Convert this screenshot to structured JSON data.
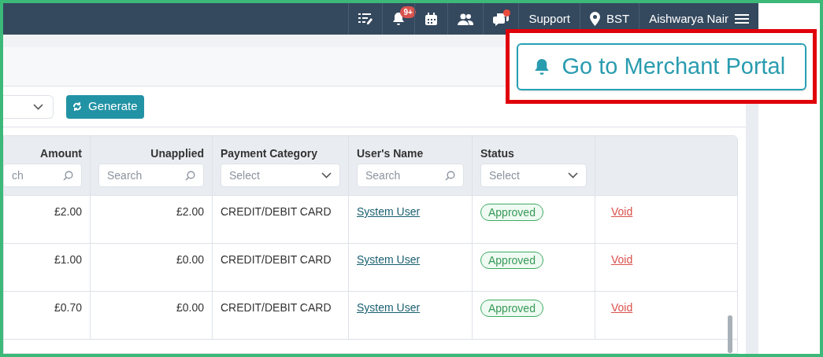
{
  "topbar": {
    "notification_badge": "9+",
    "chat_unread": true,
    "support": "Support",
    "location": "BST",
    "user": "Aishwarya Nair"
  },
  "callout": {
    "button": "Go to Merchant Portal"
  },
  "toolbar": {
    "generate": "Generate"
  },
  "table": {
    "columns": [
      {
        "label": "Amount",
        "kind": "amount",
        "placeholder": "ch"
      },
      {
        "label": "Unapplied",
        "kind": "amount",
        "placeholder": "Search"
      },
      {
        "label": "Payment Category",
        "kind": "select",
        "placeholder": "Select"
      },
      {
        "label": "User's Name",
        "kind": "search",
        "placeholder": "Search"
      },
      {
        "label": "Status",
        "kind": "select",
        "placeholder": "Select"
      }
    ],
    "rows": [
      {
        "amount": "£2.00",
        "unapplied": "£2.00",
        "category": "CREDIT/DEBIT CARD",
        "user": "System User",
        "status": "Approved",
        "action": "Void"
      },
      {
        "amount": "£1.00",
        "unapplied": "£0.00",
        "category": "CREDIT/DEBIT CARD",
        "user": "System User",
        "status": "Approved",
        "action": "Void"
      },
      {
        "amount": "£0.70",
        "unapplied": "£0.00",
        "category": "CREDIT/DEBIT CARD",
        "user": "System User",
        "status": "Approved",
        "action": "Void"
      }
    ]
  }
}
